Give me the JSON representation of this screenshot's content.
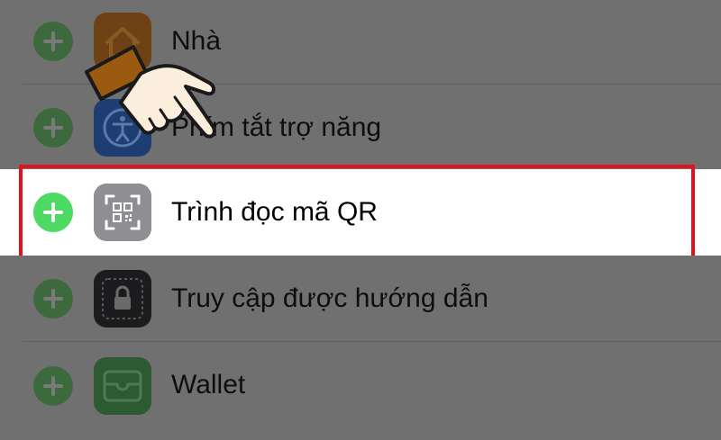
{
  "rows": [
    {
      "label": "Nhà",
      "icon": "home-app-icon",
      "highlighted": false
    },
    {
      "label": "Phím tắt trợ năng",
      "icon": "accessibility-app-icon",
      "highlighted": false
    },
    {
      "label": "Trình đọc mã QR",
      "icon": "qr-scanner-app-icon",
      "highlighted": true
    },
    {
      "label": "Truy cập được hướng dẫn",
      "icon": "guided-access-app-icon",
      "highlighted": false
    },
    {
      "label": "Wallet",
      "icon": "wallet-app-icon",
      "highlighted": false
    }
  ],
  "add_control_icon": "plus-circle-icon",
  "pointer_icon": "pointing-hand-icon",
  "colors": {
    "dim_background": "#707070",
    "highlight_background": "#ffffff",
    "highlight_border": "#e0121b",
    "add_green": "#4cd964",
    "add_green_dimmed": "#3c6a3d",
    "home_icon": "#b86a10",
    "accessibility_icon": "#1e4e9a",
    "qr_icon": "#8e8e93",
    "guided_access_icon": "#1c1c1e",
    "wallet_icon": "#3b7a40"
  }
}
